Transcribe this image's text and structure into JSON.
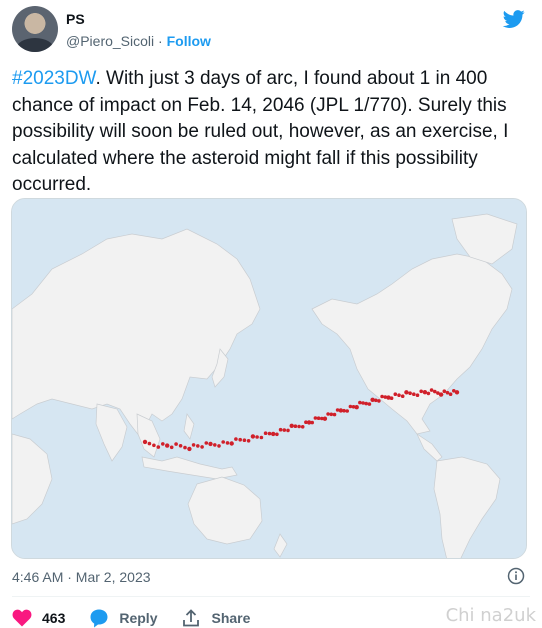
{
  "author": {
    "name": "PS",
    "handle": "@Piero_Sicoli",
    "separator": " · ",
    "follow_label": "Follow",
    "avatar_icon": "user-avatar"
  },
  "tweet": {
    "hashtag": "#2023DW",
    "body": ". With just 3 days of arc, I found about 1 in 400 chance of impact on Feb. 14, 2046 (JPL 1/770). Surely this possibility will soon be ruled out, however, as an exercise, I calculated where the asteroid might fall if this possibility occurred."
  },
  "media": {
    "type": "world-map",
    "land_color": "#f2f2f2",
    "water_color": "#d6e6f2",
    "point_color": "#d0202a"
  },
  "meta": {
    "timestamp": "4:46 AM · Mar 2, 2023"
  },
  "actions": {
    "like_count": "463",
    "reply_label": "Reply",
    "share_label": "Share"
  },
  "colors": {
    "accent": "#1d9bf0",
    "like": "#f91880",
    "secondary_text": "#536471"
  },
  "watermark": "Chi na2uk"
}
